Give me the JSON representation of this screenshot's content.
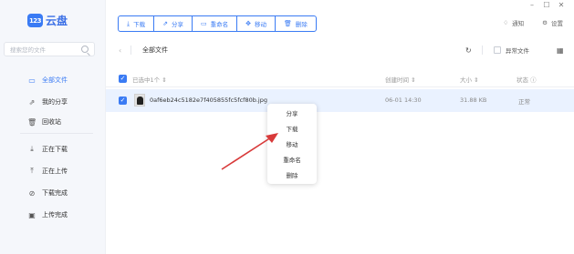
{
  "app": {
    "logo_badge": "123",
    "logo_text": "云盘"
  },
  "sidebar": {
    "search_placeholder": "搜索您的文件",
    "items": [
      {
        "label": "全部文件",
        "icon": "folder-icon"
      },
      {
        "label": "我的分享",
        "icon": "share-icon"
      },
      {
        "label": "回收站",
        "icon": "trash-icon"
      },
      {
        "label": "正在下载",
        "icon": "download-icon"
      },
      {
        "label": "正在上传",
        "icon": "upload-icon"
      },
      {
        "label": "下载完成",
        "icon": "check-circle-icon"
      },
      {
        "label": "上传完成",
        "icon": "file-done-icon"
      }
    ]
  },
  "toolbar": {
    "download": "下载",
    "share": "分享",
    "rename": "重命名",
    "move": "移动",
    "delete": "删除"
  },
  "topright": {
    "notify": "通知",
    "settings": "设置"
  },
  "pathbar": {
    "crumb": "全部文件",
    "abnormal_files": "异常文件"
  },
  "table": {
    "header": {
      "selected": "已选中1个",
      "created": "创建时间",
      "size": "大小",
      "status": "状态"
    },
    "rows": [
      {
        "name": "0af6eb24c5182e7f405855fc5fcf80b.jpg",
        "created": "06-01 14:30",
        "size": "31.88 KB",
        "status": "正常"
      }
    ]
  },
  "context_menu": {
    "items": [
      "分享",
      "下载",
      "移动",
      "重命名",
      "删除"
    ]
  },
  "colors": {
    "accent": "#3a7bf4",
    "annotation_arrow": "#d83a3a"
  }
}
